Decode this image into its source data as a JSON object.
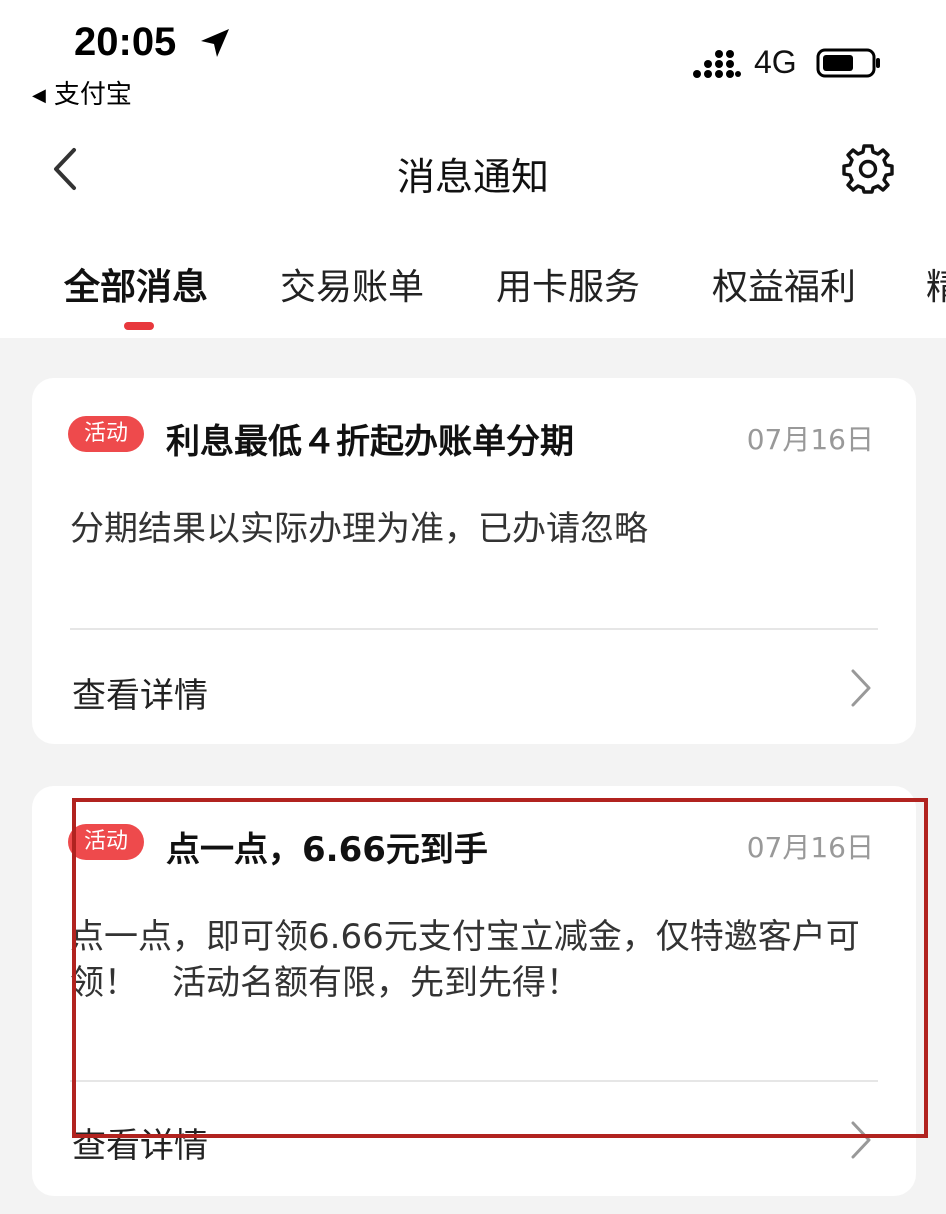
{
  "status_bar": {
    "time": "20:05",
    "back_app": "支付宝",
    "network": "4G"
  },
  "nav": {
    "title": "消息通知"
  },
  "tabs": [
    {
      "label": "全部消息",
      "active": true
    },
    {
      "label": "交易账单",
      "active": false
    },
    {
      "label": "用卡服务",
      "active": false
    },
    {
      "label": "权益福利",
      "active": false
    },
    {
      "label": "精",
      "active": false
    }
  ],
  "messages": [
    {
      "badge": "活动",
      "title": "利息最低４折起办账单分期",
      "date": "07月16日",
      "body": "分期结果以实际办理为准，已办请忽略",
      "action": "查看详情"
    },
    {
      "badge": "活动",
      "title": "点一点，6.66元到手",
      "date": "07月16日",
      "body": "点一点，即可领6.66元支付宝立减金，仅特邀客户可领！　活动名额有限，先到先得！",
      "action": "查看详情"
    }
  ],
  "colors": {
    "accent": "#e8383d",
    "badge": "#ee4a4c",
    "highlight_border": "#b1231f"
  }
}
